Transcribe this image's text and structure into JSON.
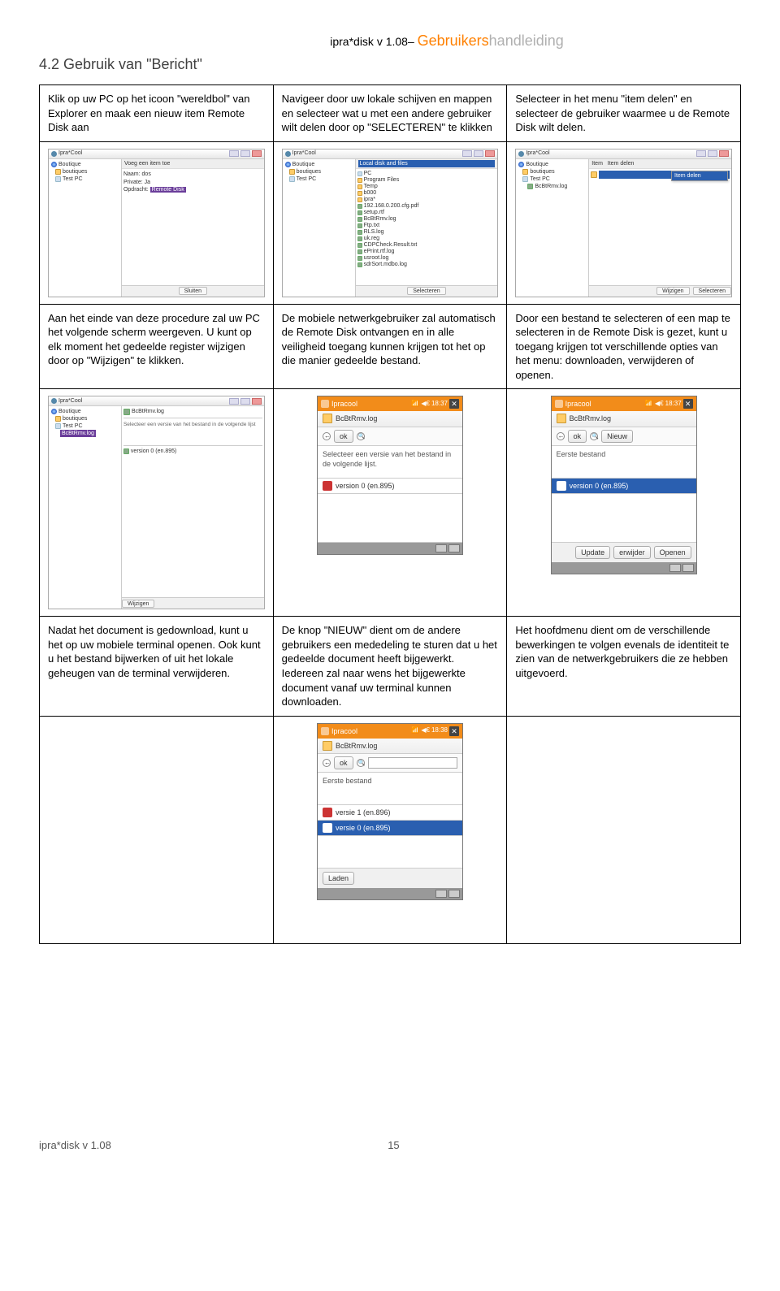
{
  "header": {
    "prefix": "ipra*disk v 1.08–",
    "title1": "Gebruikers",
    "title2": "handleiding"
  },
  "section_title": "4.2 Gebruik van \"Bericht\"",
  "row1": {
    "c1": "Klik op uw PC op het icoon \"wereldbol\" van Explorer en maak een nieuw item Remote Disk aan",
    "c2": "Navigeer door uw lokale schijven en mappen en selecteer wat u met een andere gebruiker wilt delen door op \"SELECTEREN\" te klikken",
    "c3": "Selecteer in het menu \"item delen\" en selecteer de gebruiker waarmee u de Remote Disk wilt delen."
  },
  "row3": {
    "c1": "Aan het einde van deze procedure zal uw PC het volgende scherm weergeven. U kunt op elk moment het gedeelde register wijzigen door op \"Wijzigen\" te klikken.",
    "c2": "De mobiele netwerkgebruiker zal automatisch de Remote Disk ontvangen en in alle veiligheid toegang kunnen krijgen tot het op die manier gedeelde bestand.",
    "c3": "Door een bestand te selecteren of een map te selecteren in de Remote Disk is gezet, kunt u toegang krijgen tot verschillende opties van het menu: downloaden, verwijderen of openen."
  },
  "row5": {
    "c1": "Nadat het document is gedownload, kunt u het op uw mobiele terminal openen. Ook kunt u het bestand bijwerken of uit het lokale geheugen van de terminal verwijderen.",
    "c2": "De knop \"NIEUW\" dient om de andere gebruikers een mededeling te sturen dat u het gedeelde document heeft bijgewerkt. Iedereen zal naar wens het bijgewerkte document vanaf uw terminal kunnen downloaden.",
    "c3": "Het hoofdmenu dient om de verschillende bewerkingen te volgen evenals de identiteit te zien van de netwerkgebruikers die ze hebben uitgevoerd."
  },
  "desktop": {
    "title": "Ipra*Cool",
    "tree": {
      "root": "Boutique",
      "n1": "boutiques",
      "n2": "Test PC",
      "n3": "BcBtRmv.log"
    },
    "pane_a": {
      "header": "Voeg een item toe",
      "l1": "Naam: dos",
      "l2": "Private: Ja",
      "l3_label": "Opdracht:",
      "l3_hl": "Remote Disk"
    },
    "pane_b": {
      "header": "Local disk and files",
      "files": [
        "PC",
        "Program Files",
        "Temp",
        "b000",
        "ipra*",
        "192.168.0.200.cfg.pdf",
        "setup.rtf",
        "BcBtRmv.log",
        "Ftp.txt",
        "RLS.log",
        "uk.reg",
        "CDPCheck.Result.txt",
        "ePrint.rtf.log",
        "usroot.log",
        "sdrSort.mdbo.log"
      ]
    },
    "pane_c": {
      "header": "Item delen",
      "menu": "Item"
    },
    "pane_d": {
      "rowfile": "BcBtRmv.log",
      "note": "Selecteer een versie van het bestand in de volgende lijst",
      "version": "version 0 (en.895)"
    },
    "status": {
      "single": "Sluiten",
      "left": "Wijzigen",
      "right": "Selecteren"
    }
  },
  "mobile": {
    "app": "Ipracool",
    "time1": "18:37",
    "time2": "18:38",
    "file": "BcBtRmv.log",
    "ok": "ok",
    "nieuw": "Nieuw",
    "select_text": "Selecteer een versie van het bestand in de volgende lijst.",
    "eerste": "Eerste bestand",
    "version0": "version 0  (en.895)",
    "versie0": "versie 0 (en.895)",
    "versie1": "versie 1 (en.896)",
    "update": "Update",
    "verwijder": "erwijder",
    "openen": "Openen",
    "laden": "Laden"
  },
  "footer": {
    "left": "ipra*disk v 1.08",
    "page": "15"
  }
}
